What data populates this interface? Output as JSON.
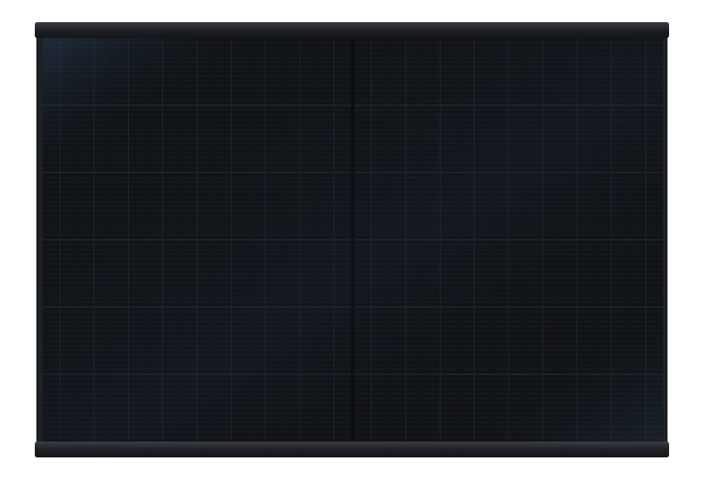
{
  "image": {
    "subject": "solar-panel",
    "background_color": "#ffffff"
  },
  "panel": {
    "frame_color": "#1e2024",
    "frame_highlight": "#3a3d42",
    "cell_color": "#101317",
    "cell_sheen": "#2a3a4c",
    "busbar_color": "#3c4148",
    "split_line_color": "#0a0b0d",
    "cell_columns_per_half": 9,
    "cell_rows": 6,
    "halves": 2,
    "fingers_per_cell": 14
  }
}
